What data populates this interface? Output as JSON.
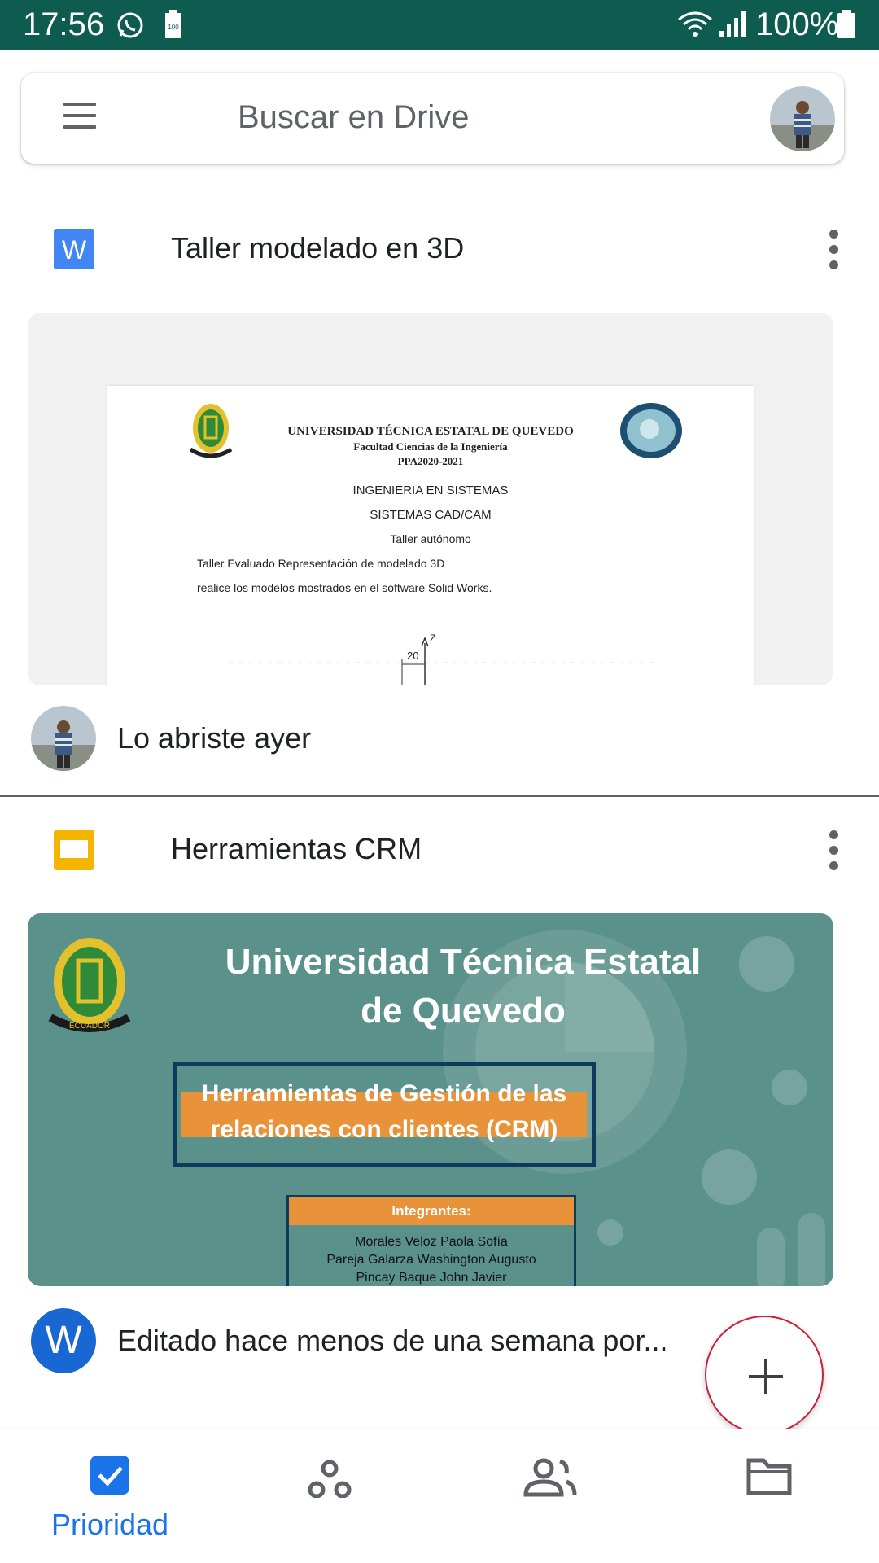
{
  "status_bar": {
    "time": "17:56",
    "battery_percent": "100%",
    "small_battery_badge": "100",
    "bg_color": "#0d5c4f"
  },
  "search": {
    "placeholder": "Buscar en Drive"
  },
  "files": [
    {
      "type_icon": "word-doc-icon",
      "title": "Taller modelado en 3D",
      "activity": "Lo abriste ayer",
      "preview": {
        "university": "UNIVERSIDAD TÉCNICA ESTATAL DE QUEVEDO",
        "faculty": "Facultad Ciencias de la Ingeniería",
        "period": "PPA2020-2021",
        "career": "INGENIERIA EN SISTEMAS",
        "subject": "SISTEMAS CAD/CAM",
        "kind": "Taller autónomo",
        "line1": "Taller Evaluado  Representación de modelado 3D",
        "line2": "realice los modelos mostrados en el software Solid Works.",
        "drawing_dim": "20",
        "drawing_axis": "Z"
      }
    },
    {
      "type_icon": "slides-icon",
      "title": "Herramientas CRM",
      "activity": "Editado hace menos de una semana por...",
      "activity_avatar_letter": "W",
      "preview": {
        "title_line1": "Universidad Técnica Estatal",
        "title_line2": "de Quevedo",
        "subtitle_line1": "Herramientas de Gestión de las",
        "subtitle_line2": "relaciones con clientes (CRM)",
        "members_header": "Integrantes:",
        "members": [
          "Morales Veloz Paola Sofía",
          "Pareja Galarza Washington Augusto",
          "Pincay Baque John Javier"
        ],
        "seal_text": "ECUADOR"
      }
    }
  ],
  "bottom_nav": [
    {
      "label": "Prioridad",
      "icon": "priority-check-icon",
      "active": true
    },
    {
      "label": "",
      "icon": "suggested-icon",
      "active": false
    },
    {
      "label": "",
      "icon": "shared-people-icon",
      "active": false
    },
    {
      "label": "",
      "icon": "folder-icon",
      "active": false
    }
  ],
  "colors": {
    "accent": "#1a73e8",
    "fab_border": "#c9213b",
    "slides_bg": "#5b918b",
    "slides_orange": "#e8923a",
    "word_blue": "#4285f4",
    "slides_yellow": "#f4b400"
  }
}
